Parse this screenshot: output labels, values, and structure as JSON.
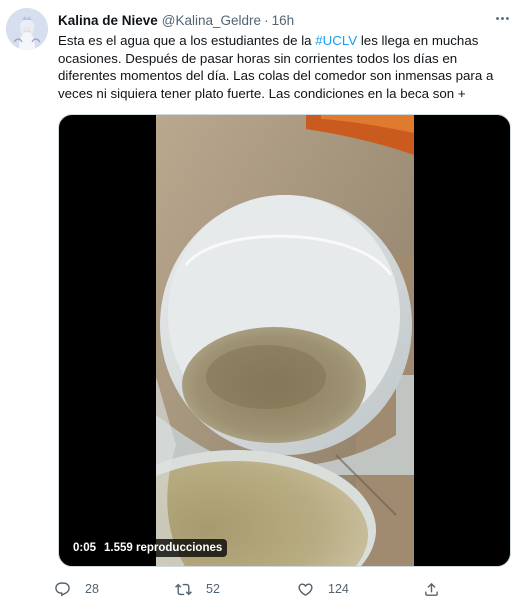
{
  "author": {
    "display_name": "Kalina de Nieve",
    "handle": "@Kalina_Geldre",
    "separator": "·",
    "time": "16h"
  },
  "tweet": {
    "line1_before": "Esta es el agua que a los estudiantes de la ",
    "hashtag": "#UCLV",
    "line1_after": " les llega en muchas",
    "line2": "ocasiones. Después de pasar horas sin corrientes todos los días en",
    "line3": "diferentes momentos del día. Las colas del comedor son inmensas para a",
    "line4": "veces ni siquiera tener plato fuerte. Las condiciones en la beca son +"
  },
  "media": {
    "timestamp": "0:05",
    "views": "1.559 reproducciones"
  },
  "actions": {
    "replies": "28",
    "retweets": "52",
    "likes": "124"
  },
  "icons": {
    "more": "more-horizontal-icon",
    "reply": "reply-icon",
    "retweet": "retweet-icon",
    "like": "heart-icon",
    "share": "share-icon"
  },
  "colors": {
    "link": "#1d9bf0",
    "secondary_text": "#536471",
    "primary_text": "#0f1419"
  }
}
